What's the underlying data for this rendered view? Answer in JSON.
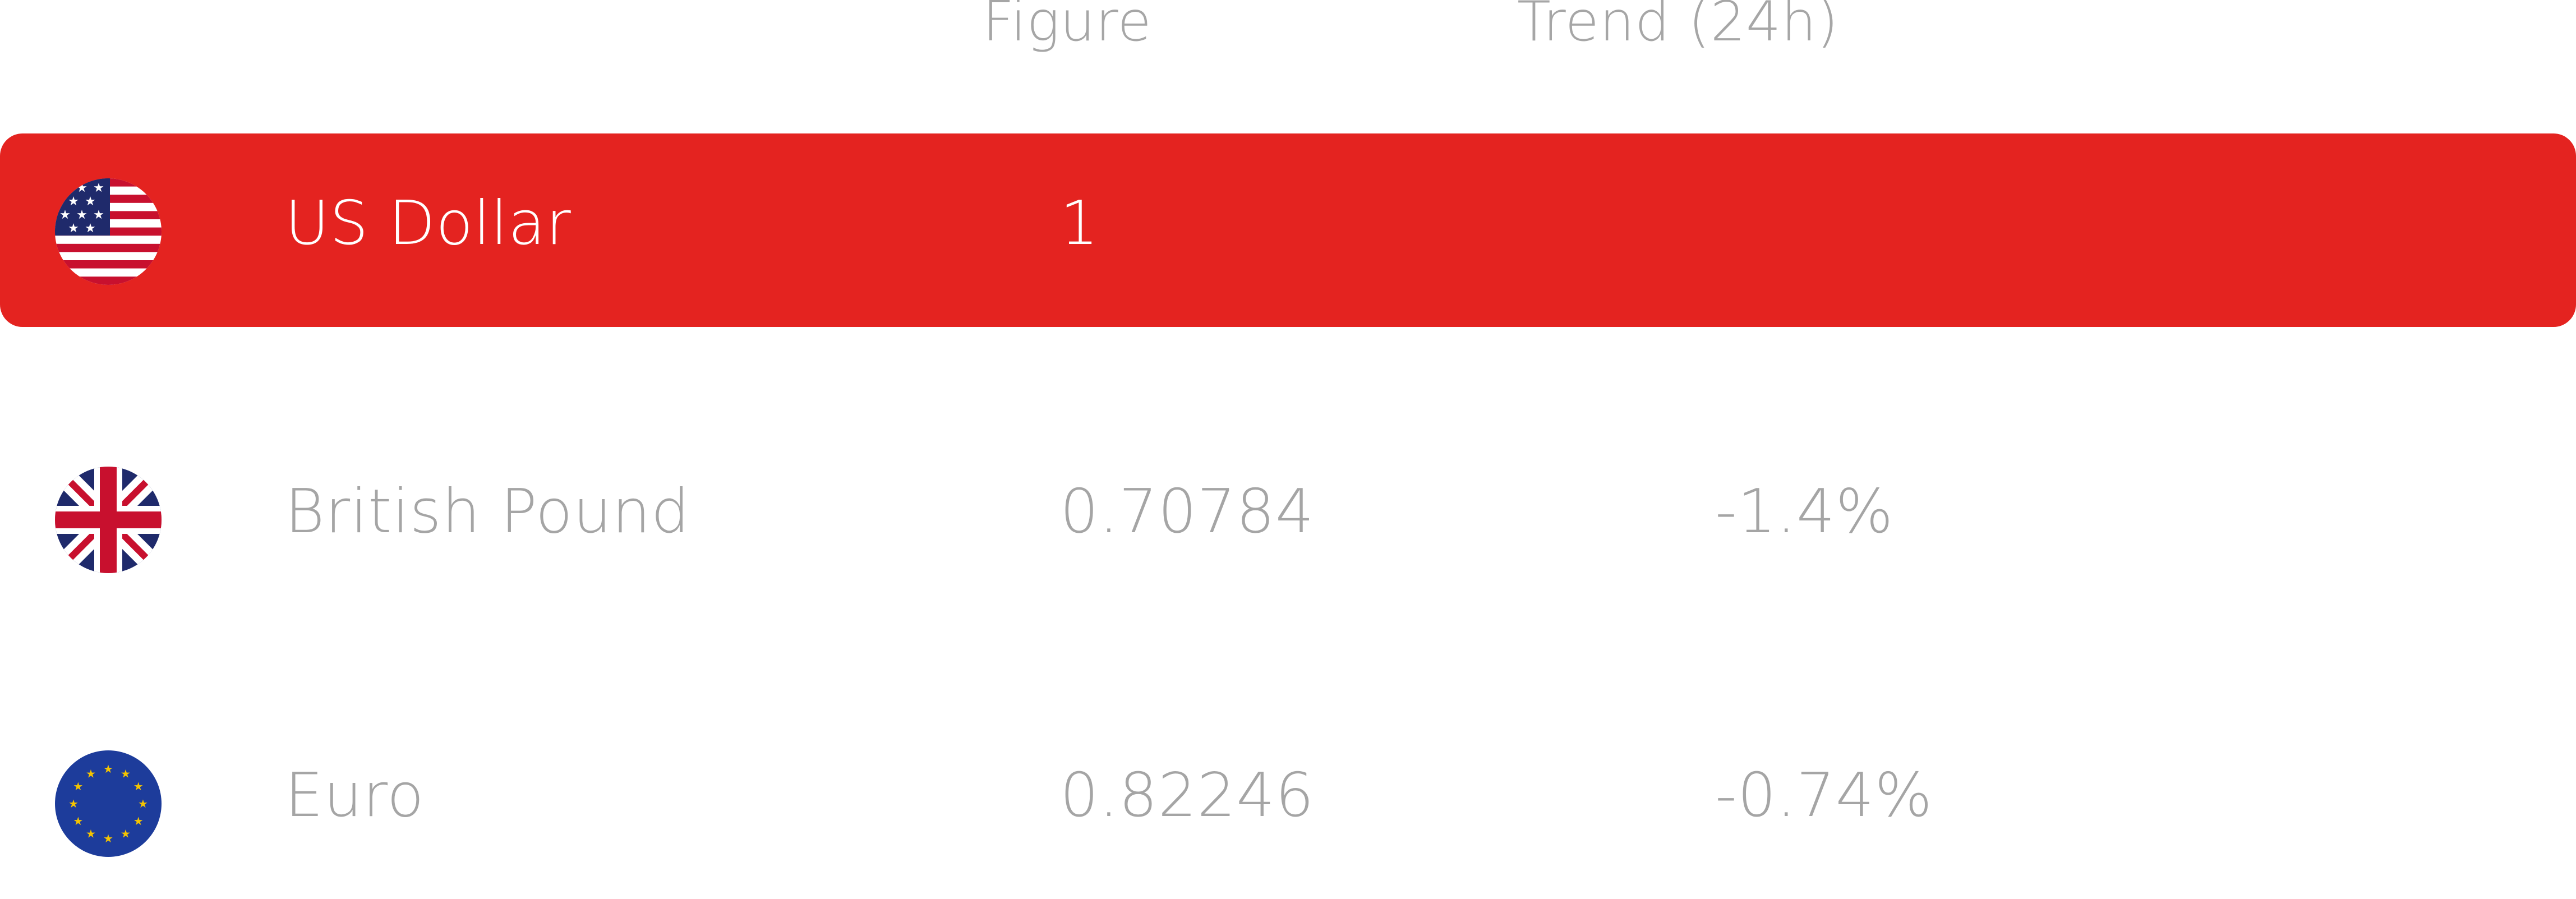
{
  "header": {
    "figure_label": "Figure",
    "trend_label": "Trend (24h)"
  },
  "rows": [
    {
      "name": "US Dollar",
      "figure": "1",
      "trend": "",
      "icon": "us-flag-icon",
      "selected": true
    },
    {
      "name": "British Pound",
      "figure": "0.70784",
      "trend": "-1.4%",
      "icon": "uk-flag-icon",
      "selected": false
    },
    {
      "name": "Euro",
      "figure": "0.82246",
      "trend": "-0.74%",
      "icon": "eu-flag-icon",
      "selected": false
    }
  ],
  "colors": {
    "selected_row_bg": "#e42320",
    "text_muted": "#a5a5a5",
    "text_selected": "#ffffff"
  }
}
